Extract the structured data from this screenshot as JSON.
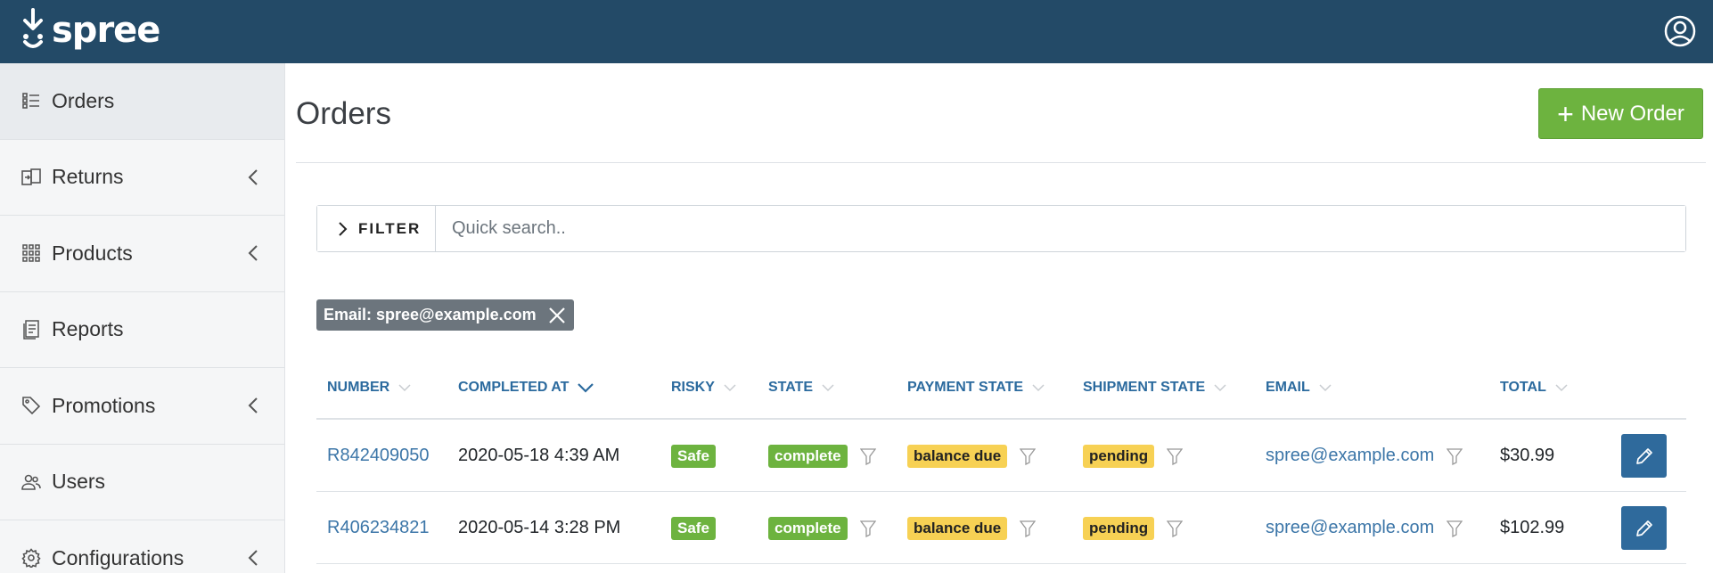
{
  "topbar": {
    "brand": "spree",
    "user_icon": "user-circle-icon"
  },
  "sidebar": {
    "items": [
      {
        "label": "Orders",
        "icon": "list-icon",
        "chevron": false,
        "active": true
      },
      {
        "label": "Returns",
        "icon": "returns-icon",
        "chevron": true
      },
      {
        "label": "Products",
        "icon": "grid-icon",
        "chevron": true
      },
      {
        "label": "Reports",
        "icon": "report-icon",
        "chevron": false
      },
      {
        "label": "Promotions",
        "icon": "tag-icon",
        "chevron": true
      },
      {
        "label": "Users",
        "icon": "users-icon",
        "chevron": false
      },
      {
        "label": "Configurations",
        "icon": "gear-icon",
        "chevron": true
      }
    ]
  },
  "main": {
    "title": "Orders",
    "new_order_label": "New Order",
    "filter_label": "FILTER",
    "search_placeholder": "Quick search..",
    "active_filter": "Email: spree@example.com"
  },
  "table": {
    "columns": [
      "NUMBER",
      "COMPLETED AT",
      "RISKY",
      "STATE",
      "PAYMENT STATE",
      "SHIPMENT STATE",
      "EMAIL",
      "TOTAL"
    ],
    "rows": [
      {
        "number": "R842409050",
        "completed_at": "2020-05-18 4:39 AM",
        "risky": "Safe",
        "state": "complete",
        "payment_state": "balance due",
        "shipment_state": "pending",
        "email": "spree@example.com",
        "total": "$30.99"
      },
      {
        "number": "R406234821",
        "completed_at": "2020-05-14 3:28 PM",
        "risky": "Safe",
        "state": "complete",
        "payment_state": "balance due",
        "shipment_state": "pending",
        "email": "spree@example.com",
        "total": "$102.99"
      }
    ]
  },
  "colors": {
    "topbar": "#234a67",
    "accent_green": "#6db33f",
    "link_blue": "#3c76a8",
    "badge_yellow": "#f7d154",
    "edit_button": "#2f6a9c"
  }
}
